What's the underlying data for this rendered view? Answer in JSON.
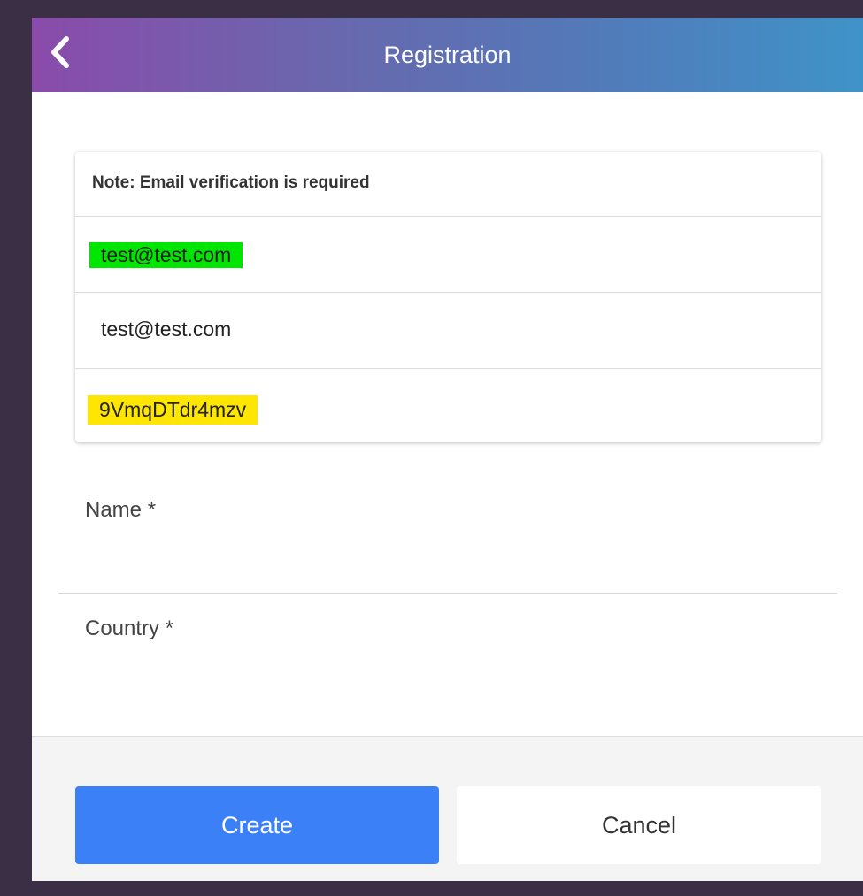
{
  "header": {
    "title": "Registration",
    "back_icon": "chevron-left-icon"
  },
  "card": {
    "note": "Note: Email verification is required",
    "email": "test@test.com",
    "email_highlight_color": "#00e600",
    "confirm_email": "test@test.com",
    "password": "9VmqDTdr4mzv",
    "password_highlight_color": "#ffe600"
  },
  "form": {
    "name_label": "Name *",
    "country_label": "Country *"
  },
  "footer": {
    "create_label": "Create",
    "cancel_label": "Cancel",
    "create_color": "#3b80f6"
  }
}
